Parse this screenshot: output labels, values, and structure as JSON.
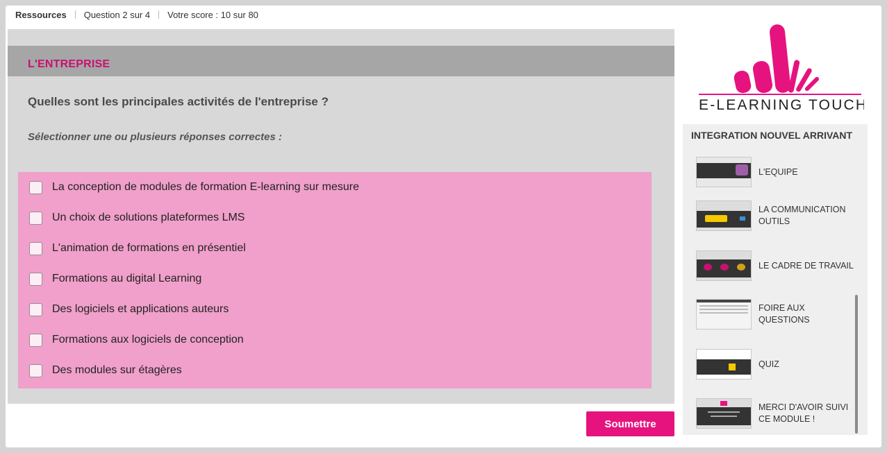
{
  "topbar": {
    "resources": "Ressources",
    "question_progress": "Question 2 sur 4",
    "score": "Votre score : 10 sur 80"
  },
  "quiz": {
    "section": "L'ENTREPRISE",
    "question": "Quelles sont les principales activités de l'entreprise ?",
    "instruction": "Sélectionner une ou plusieurs réponses correctes :",
    "answers": [
      "La conception de modules de formation E-learning sur mesure",
      "Un choix de solutions plateformes LMS",
      "L'animation de formations en présentiel",
      "Formations au digital Learning",
      "Des logiciels et applications auteurs",
      "Formations aux logiciels de conception",
      "Des modules sur étagères"
    ],
    "submit_label": "Soumettre"
  },
  "logo": {
    "text": "E-LEARNING TOUCH’"
  },
  "sidebar": {
    "title": "INTEGRATION NOUVEL ARRIVANT",
    "items": [
      {
        "label": "L'EQUIPE"
      },
      {
        "label": "LA COMMUNICATION OUTILS"
      },
      {
        "label": "LE CADRE DE TRAVAIL"
      },
      {
        "label": "FOIRE AUX QUESTIONS"
      },
      {
        "label": "QUIZ"
      },
      {
        "label": "MERCI D'AVOIR SUIVI CE MODULE !"
      }
    ]
  },
  "colors": {
    "accent": "#e6137f",
    "section_title": "#c8116f",
    "answers_bg": "#f0a0ca",
    "panel_bg": "#d8d8d8"
  }
}
